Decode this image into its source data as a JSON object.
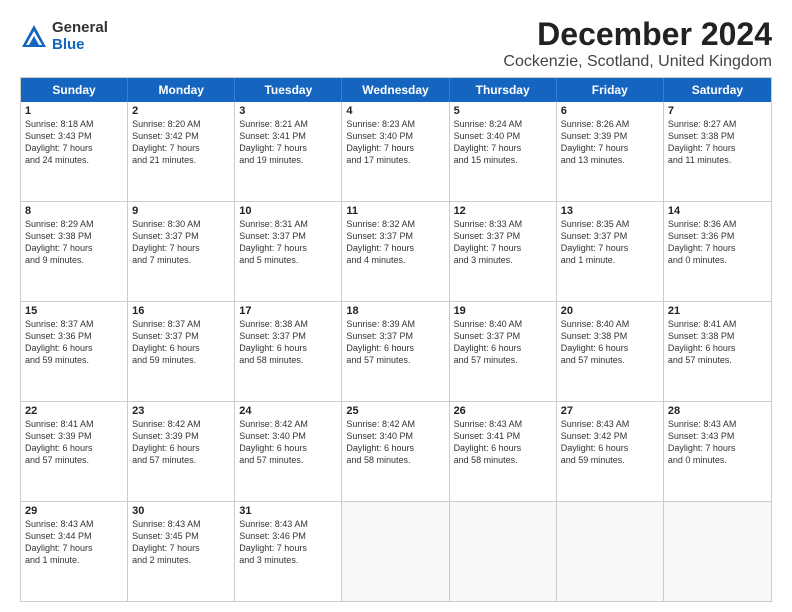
{
  "logo": {
    "general": "General",
    "blue": "Blue"
  },
  "title": "December 2024",
  "subtitle": "Cockenzie, Scotland, United Kingdom",
  "header_days": [
    "Sunday",
    "Monday",
    "Tuesday",
    "Wednesday",
    "Thursday",
    "Friday",
    "Saturday"
  ],
  "rows": [
    [
      {
        "day": "1",
        "text": "Sunrise: 8:18 AM\nSunset: 3:43 PM\nDaylight: 7 hours\nand 24 minutes."
      },
      {
        "day": "2",
        "text": "Sunrise: 8:20 AM\nSunset: 3:42 PM\nDaylight: 7 hours\nand 21 minutes."
      },
      {
        "day": "3",
        "text": "Sunrise: 8:21 AM\nSunset: 3:41 PM\nDaylight: 7 hours\nand 19 minutes."
      },
      {
        "day": "4",
        "text": "Sunrise: 8:23 AM\nSunset: 3:40 PM\nDaylight: 7 hours\nand 17 minutes."
      },
      {
        "day": "5",
        "text": "Sunrise: 8:24 AM\nSunset: 3:40 PM\nDaylight: 7 hours\nand 15 minutes."
      },
      {
        "day": "6",
        "text": "Sunrise: 8:26 AM\nSunset: 3:39 PM\nDaylight: 7 hours\nand 13 minutes."
      },
      {
        "day": "7",
        "text": "Sunrise: 8:27 AM\nSunset: 3:38 PM\nDaylight: 7 hours\nand 11 minutes."
      }
    ],
    [
      {
        "day": "8",
        "text": "Sunrise: 8:29 AM\nSunset: 3:38 PM\nDaylight: 7 hours\nand 9 minutes."
      },
      {
        "day": "9",
        "text": "Sunrise: 8:30 AM\nSunset: 3:37 PM\nDaylight: 7 hours\nand 7 minutes."
      },
      {
        "day": "10",
        "text": "Sunrise: 8:31 AM\nSunset: 3:37 PM\nDaylight: 7 hours\nand 5 minutes."
      },
      {
        "day": "11",
        "text": "Sunrise: 8:32 AM\nSunset: 3:37 PM\nDaylight: 7 hours\nand 4 minutes."
      },
      {
        "day": "12",
        "text": "Sunrise: 8:33 AM\nSunset: 3:37 PM\nDaylight: 7 hours\nand 3 minutes."
      },
      {
        "day": "13",
        "text": "Sunrise: 8:35 AM\nSunset: 3:37 PM\nDaylight: 7 hours\nand 1 minute."
      },
      {
        "day": "14",
        "text": "Sunrise: 8:36 AM\nSunset: 3:36 PM\nDaylight: 7 hours\nand 0 minutes."
      }
    ],
    [
      {
        "day": "15",
        "text": "Sunrise: 8:37 AM\nSunset: 3:36 PM\nDaylight: 6 hours\nand 59 minutes."
      },
      {
        "day": "16",
        "text": "Sunrise: 8:37 AM\nSunset: 3:37 PM\nDaylight: 6 hours\nand 59 minutes."
      },
      {
        "day": "17",
        "text": "Sunrise: 8:38 AM\nSunset: 3:37 PM\nDaylight: 6 hours\nand 58 minutes."
      },
      {
        "day": "18",
        "text": "Sunrise: 8:39 AM\nSunset: 3:37 PM\nDaylight: 6 hours\nand 57 minutes."
      },
      {
        "day": "19",
        "text": "Sunrise: 8:40 AM\nSunset: 3:37 PM\nDaylight: 6 hours\nand 57 minutes."
      },
      {
        "day": "20",
        "text": "Sunrise: 8:40 AM\nSunset: 3:38 PM\nDaylight: 6 hours\nand 57 minutes."
      },
      {
        "day": "21",
        "text": "Sunrise: 8:41 AM\nSunset: 3:38 PM\nDaylight: 6 hours\nand 57 minutes."
      }
    ],
    [
      {
        "day": "22",
        "text": "Sunrise: 8:41 AM\nSunset: 3:39 PM\nDaylight: 6 hours\nand 57 minutes."
      },
      {
        "day": "23",
        "text": "Sunrise: 8:42 AM\nSunset: 3:39 PM\nDaylight: 6 hours\nand 57 minutes."
      },
      {
        "day": "24",
        "text": "Sunrise: 8:42 AM\nSunset: 3:40 PM\nDaylight: 6 hours\nand 57 minutes."
      },
      {
        "day": "25",
        "text": "Sunrise: 8:42 AM\nSunset: 3:40 PM\nDaylight: 6 hours\nand 58 minutes."
      },
      {
        "day": "26",
        "text": "Sunrise: 8:43 AM\nSunset: 3:41 PM\nDaylight: 6 hours\nand 58 minutes."
      },
      {
        "day": "27",
        "text": "Sunrise: 8:43 AM\nSunset: 3:42 PM\nDaylight: 6 hours\nand 59 minutes."
      },
      {
        "day": "28",
        "text": "Sunrise: 8:43 AM\nSunset: 3:43 PM\nDaylight: 7 hours\nand 0 minutes."
      }
    ],
    [
      {
        "day": "29",
        "text": "Sunrise: 8:43 AM\nSunset: 3:44 PM\nDaylight: 7 hours\nand 1 minute."
      },
      {
        "day": "30",
        "text": "Sunrise: 8:43 AM\nSunset: 3:45 PM\nDaylight: 7 hours\nand 2 minutes."
      },
      {
        "day": "31",
        "text": "Sunrise: 8:43 AM\nSunset: 3:46 PM\nDaylight: 7 hours\nand 3 minutes."
      },
      {
        "day": "",
        "text": ""
      },
      {
        "day": "",
        "text": ""
      },
      {
        "day": "",
        "text": ""
      },
      {
        "day": "",
        "text": ""
      }
    ]
  ]
}
